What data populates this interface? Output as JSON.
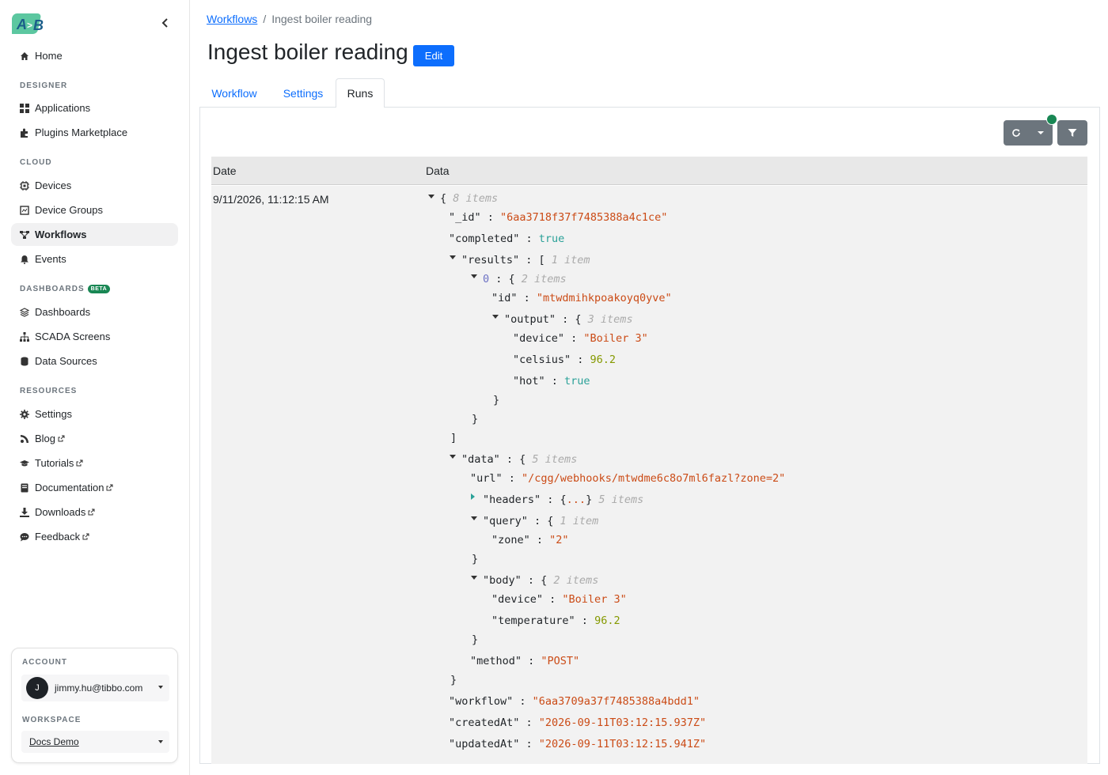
{
  "logo": {
    "text": "A>B"
  },
  "sidebar": {
    "home": "Home",
    "sections": {
      "designer": "DESIGNER",
      "cloud": "CLOUD",
      "dashboards": "DASHBOARDS",
      "beta": "BETA",
      "resources": "RESOURCES"
    },
    "items": {
      "applications": "Applications",
      "plugins": "Plugins Marketplace",
      "devices": "Devices",
      "device_groups": "Device Groups",
      "workflows": "Workflows",
      "events": "Events",
      "dashboards": "Dashboards",
      "scada": "SCADA Screens",
      "data_sources": "Data Sources",
      "settings": "Settings",
      "blog": "Blog",
      "tutorials": "Tutorials",
      "documentation": "Documentation",
      "downloads": "Downloads",
      "feedback": "Feedback"
    },
    "active": "Workflows"
  },
  "account": {
    "label": "ACCOUNT",
    "avatar_initial": "J",
    "email": "jimmy.hu@tibbo.com",
    "workspace_label": "WORKSPACE",
    "workspace": "Docs Demo"
  },
  "breadcrumb": {
    "parent": "Workflows",
    "separator": "/",
    "current": "Ingest boiler reading"
  },
  "page": {
    "title": "Ingest boiler reading",
    "edit_label": "Edit"
  },
  "tabs": [
    {
      "label": "Workflow",
      "active": false
    },
    {
      "label": "Settings",
      "active": false
    },
    {
      "label": "Runs",
      "active": true
    }
  ],
  "toolbar": {
    "refresh_icon": "refresh-icon",
    "dropdown_icon": "caret-down-icon",
    "filter_icon": "filter-icon",
    "status_color": "#198754"
  },
  "table": {
    "headers": [
      "Date",
      "Data"
    ],
    "rows": [
      {
        "date": "9/11/2026, 11:12:15 AM",
        "data": {
          "root_count": "8 items",
          "_id": "\"6aa3718f37f7485388a4c1ce\"",
          "completed": "true",
          "results_count": "1 item",
          "results_0_count": "2 items",
          "results_0_id": "\"mtwdmihkpoakoyq0yve\"",
          "output_count": "3 items",
          "output_device": "\"Boiler 3\"",
          "output_celsius": "96.2",
          "output_hot": "true",
          "data_count": "5 items",
          "data_url": "\"/cgg/webhooks/mtwdme6c8o7ml6fazl?zone=2\"",
          "headers_collapsed": "...",
          "headers_count": "5 items",
          "query_count": "1 item",
          "query_zone": "\"2\"",
          "body_count": "2 items",
          "body_device": "\"Boiler 3\"",
          "body_temperature": "96.2",
          "method": "\"POST\"",
          "workflow": "\"6aa3709a37f7485388a4bdd1\"",
          "createdAt": "\"2026-09-11T03:12:15.937Z\"",
          "updatedAt": "\"2026-09-11T03:12:15.941Z\""
        }
      }
    ]
  },
  "colors": {
    "primary": "#0d6efd",
    "string": "#cb4b16",
    "boolean": "#2aa198",
    "number": "#859900",
    "meta": "#aaaaaa",
    "beta": "#198754"
  }
}
